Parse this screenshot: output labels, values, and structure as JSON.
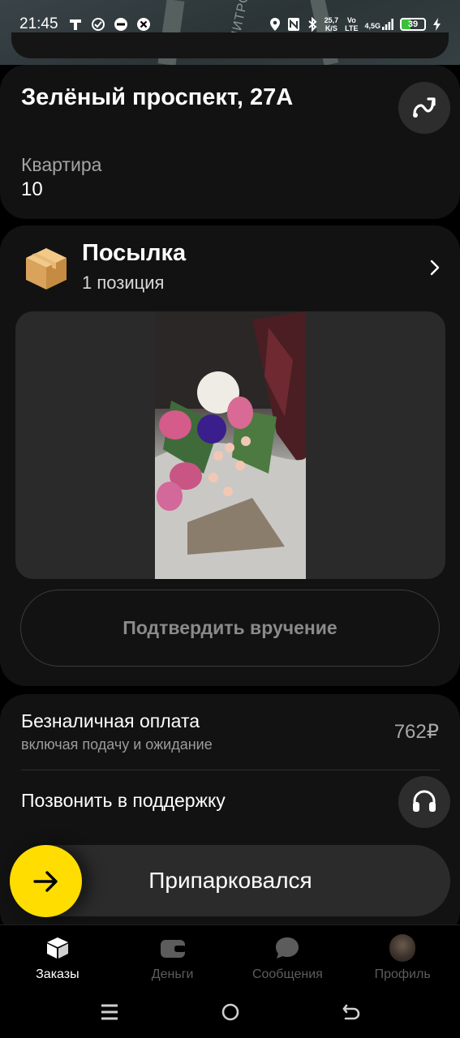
{
  "status_bar": {
    "time": "21:45",
    "speed_top": "25,7",
    "speed_bottom": "K/S",
    "volte_top": "Vo",
    "volte_bottom": "LTE",
    "network": "4,5G",
    "battery": "39"
  },
  "map": {
    "street_label": "ДМИТРО"
  },
  "address": {
    "title": "Зелёный проспект, 27А",
    "apartment_label": "Квартира",
    "apartment_value": "10"
  },
  "parcel": {
    "title": "Посылка",
    "subtitle": "1 позиция",
    "confirm_label": "Подтвердить вручение"
  },
  "payment": {
    "title": "Безналичная оплата",
    "subtitle": "включая подачу и ожидание",
    "amount": "762₽",
    "support_label": "Позвонить в поддержку"
  },
  "park": {
    "label": "Припарковался"
  },
  "tabs": [
    {
      "label": "Заказы",
      "icon": "box-icon",
      "active": true
    },
    {
      "label": "Деньги",
      "icon": "wallet-icon",
      "active": false
    },
    {
      "label": "Сообщения",
      "icon": "chat-icon",
      "active": false
    },
    {
      "label": "Профиль",
      "icon": "avatar",
      "active": false
    }
  ],
  "colors": {
    "accent": "#ffdd00",
    "card": "#121212",
    "button": "#2d2d2d"
  }
}
